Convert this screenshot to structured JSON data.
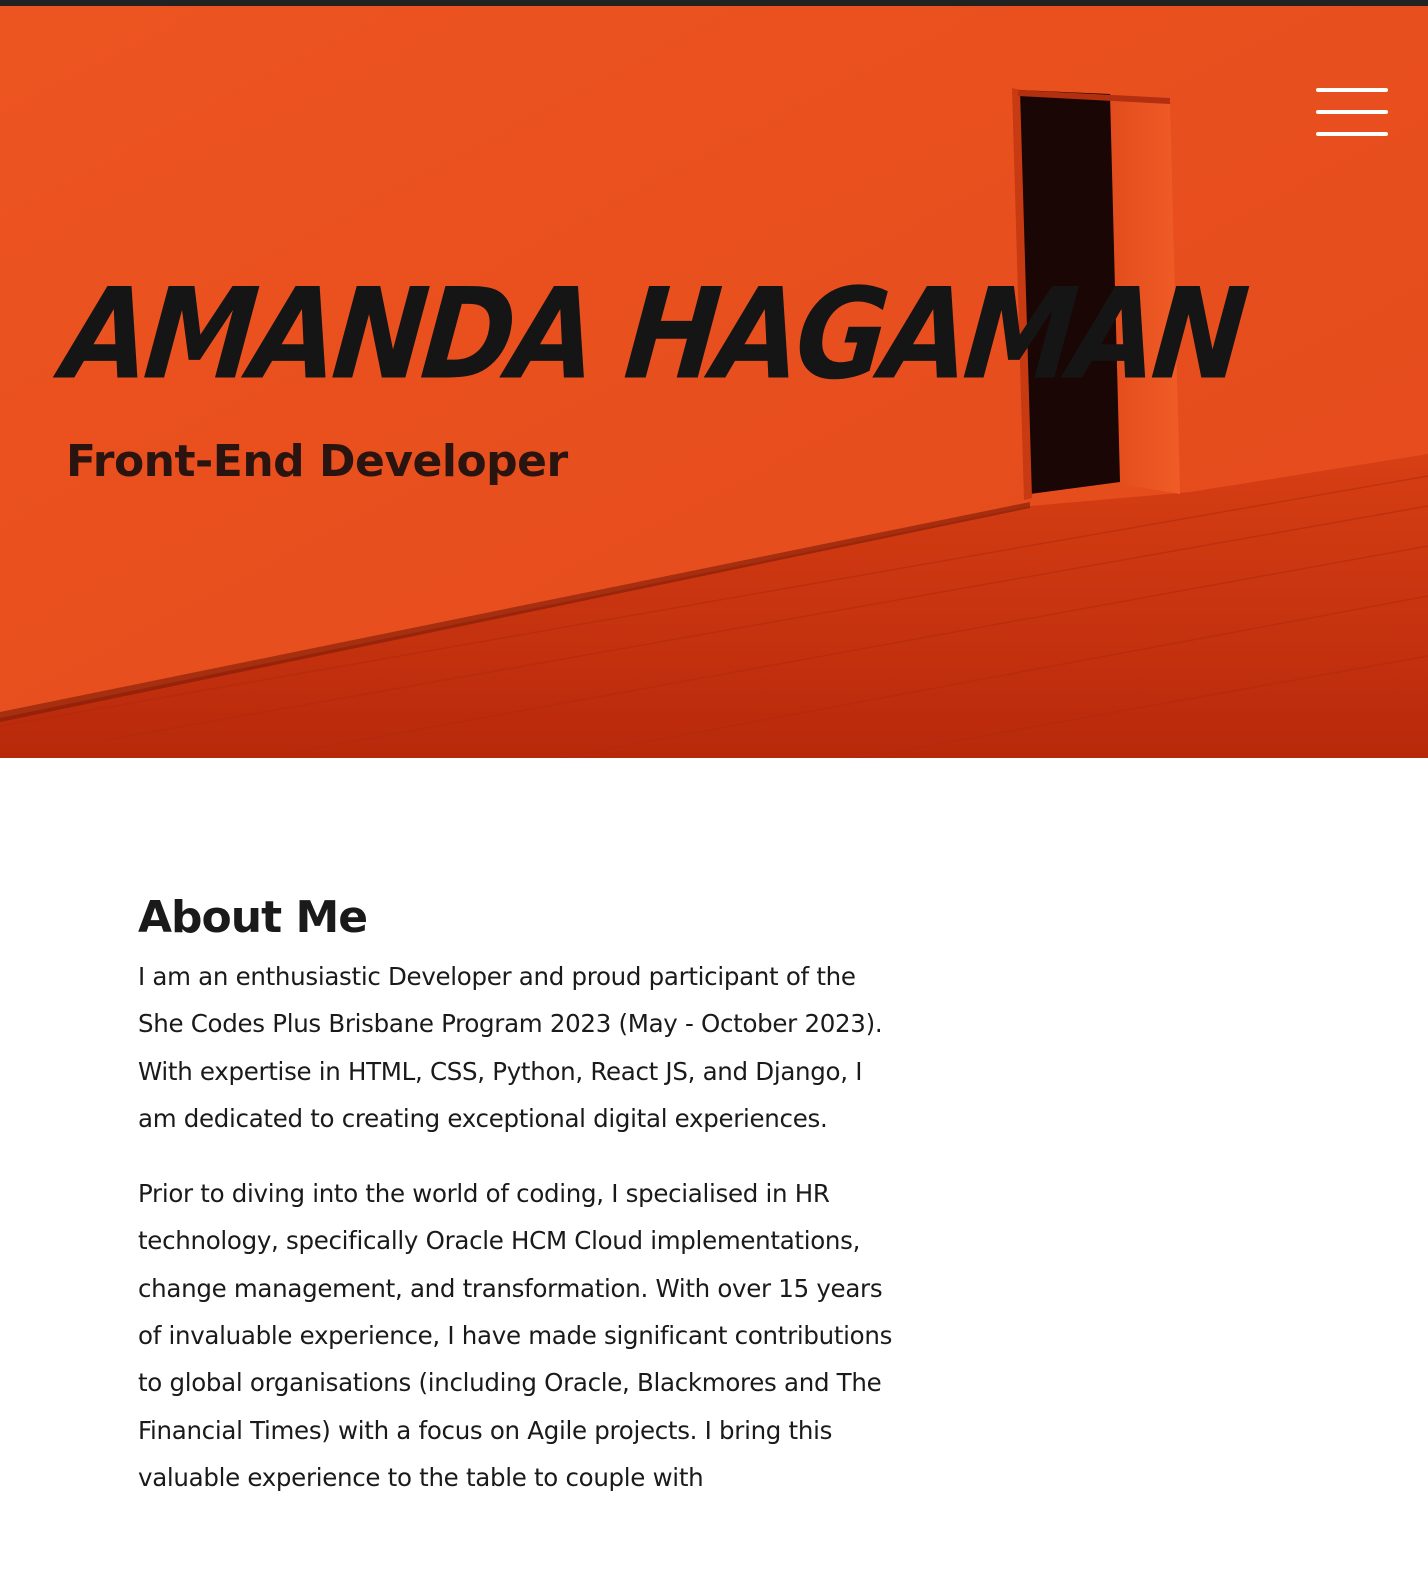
{
  "hero": {
    "name": "AMANDA HAGAMAN",
    "role": "Front-End Developer",
    "menu_icon": "hamburger-menu-icon"
  },
  "about": {
    "heading": "About Me",
    "paragraphs": [
      "I am an enthusiastic Developer and proud participant of the She Codes Plus Brisbane Program 2023 (May - October 2023). With expertise in HTML, CSS, Python, React JS, and Django, I am dedicated to creating exceptional digital experiences.",
      "Prior to diving into the world of coding, I specialised in HR technology, specifically Oracle HCM Cloud implementations, change management, and transformation. With over 15 years of invaluable experience, I have made significant contributions to global organisations (including Oracle, Blackmores and The Financial Times) with a focus on Agile projects. I bring this valuable experience to the table to couple with"
    ]
  },
  "colors": {
    "hero_orange": "#e9521f",
    "hero_floor": "#c8320f",
    "doorway": "#1a0604",
    "text_dark": "#1a1a1a",
    "topbar": "#222222"
  }
}
